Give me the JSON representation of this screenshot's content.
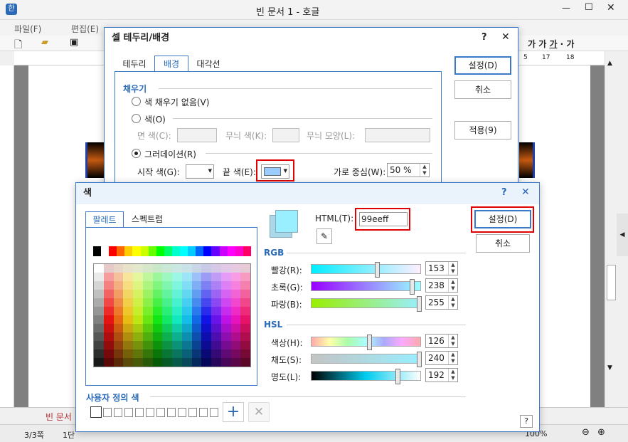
{
  "app": {
    "title": "빈 문서 1 - 호글",
    "menus": [
      "파일(F)",
      "편집(E)"
    ],
    "doc_tab": "빈 문서",
    "status_page": "3/3쪽",
    "status_section": "1단",
    "zoom": "100%",
    "ruler_marks": [
      "5",
      "17",
      "18"
    ]
  },
  "cell_dialog": {
    "title": "셀 테두리/배경",
    "help": "?",
    "close": "✕",
    "tabs": [
      "테두리",
      "배경",
      "대각선"
    ],
    "fill_section": "채우기",
    "no_fill": "색 채우기 없음(V)",
    "color_option": "색(O)",
    "face_color": "면 색(C):",
    "pattern_color": "무늬 색(K):",
    "pattern_shape": "무늬 모양(L):",
    "gradation": "그러데이션(R)",
    "start_color": "시작 색(G):",
    "end_color": "끝 색(E):",
    "h_center_label": "가로 중심(W):",
    "h_center_value": "50 %",
    "ok": "설정(D)",
    "cancel": "취소",
    "apply": "적용(9)"
  },
  "color_dialog": {
    "title": "색",
    "help": "?",
    "close": "✕",
    "tabs": [
      "팔레트",
      "스펙트럼"
    ],
    "html_label": "HTML(T):",
    "html_value": "99eeff",
    "ok": "설정(D)",
    "cancel": "취소",
    "rgb_section": "RGB",
    "hsl_section": "HSL",
    "red_label": "빨강(R):",
    "green_label": "초록(G):",
    "blue_label": "파랑(B):",
    "red": 153,
    "green": 238,
    "blue": 255,
    "hue_label": "색상(H):",
    "sat_label": "채도(S):",
    "lum_label": "명도(L):",
    "hue": 126,
    "sat": 240,
    "lum": 192,
    "custom_section": "사용자 정의 색",
    "current_color": "#99eeff",
    "help_bottom": "?"
  },
  "colors": {
    "accent": "#2a6ab8",
    "highlight": "#e00000",
    "preview": "#99eeff"
  }
}
